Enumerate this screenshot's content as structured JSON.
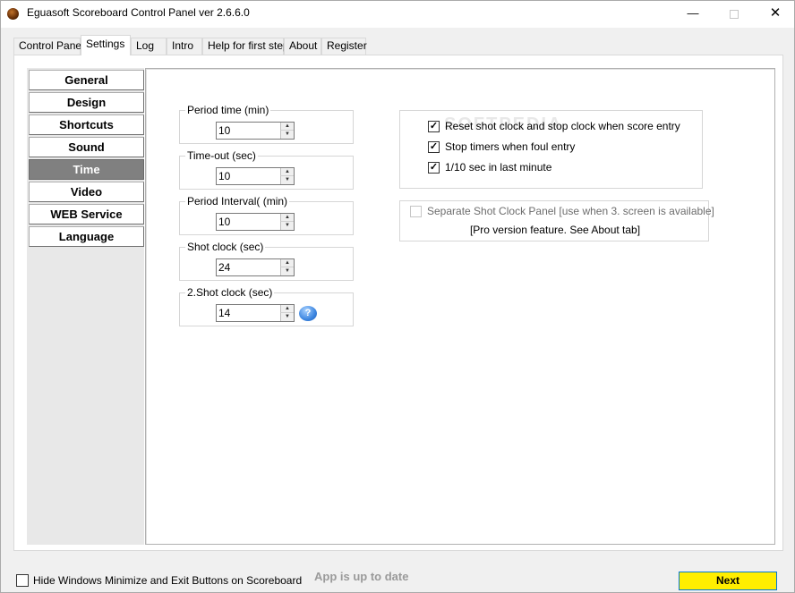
{
  "window": {
    "title": "Eguasoft Scoreboard Control Panel ver 2.6.6.0",
    "minimize_glyph": "—",
    "close_glyph": "✕"
  },
  "tabs": [
    {
      "label": "Control Panel",
      "active": false
    },
    {
      "label": "Settings",
      "active": true
    },
    {
      "label": "Log",
      "active": false
    },
    {
      "label": "Intro",
      "active": false
    },
    {
      "label": "Help for first step",
      "active": false
    },
    {
      "label": "About",
      "active": false
    },
    {
      "label": "Register",
      "active": false
    }
  ],
  "sidebar": {
    "items": [
      {
        "label": "General",
        "active": false
      },
      {
        "label": "Design",
        "active": false
      },
      {
        "label": "Shortcuts",
        "active": false
      },
      {
        "label": "Sound",
        "active": false
      },
      {
        "label": "Time",
        "active": true
      },
      {
        "label": "Video",
        "active": false
      },
      {
        "label": "WEB Service",
        "active": false
      },
      {
        "label": "Language",
        "active": false
      }
    ]
  },
  "time_settings": {
    "period_time": {
      "label": "Period time (min)",
      "value": "10"
    },
    "time_out": {
      "label": "Time-out (sec)",
      "value": "10"
    },
    "period_interval": {
      "label": "Period Interval( (min)",
      "value": "10"
    },
    "shot_clock": {
      "label": "Shot clock (sec)",
      "value": "24"
    },
    "shot_clock_2": {
      "label": "2.Shot clock (sec)",
      "value": "14"
    }
  },
  "options": {
    "reset_shot_clock": {
      "label": "Reset shot clock and stop clock when score entry",
      "checked": true
    },
    "stop_timers_foul": {
      "label": "Stop timers when foul entry",
      "checked": true
    },
    "tenth_sec_last_minute": {
      "label": "1/10 sec in last minute",
      "checked": true
    },
    "watermark": "SOFTPEDIA"
  },
  "pro_feature": {
    "label": "Separate Shot Clock Panel [use when 3. screen is available]",
    "note": "[Pro version feature. See About tab]",
    "checked": false,
    "enabled": false
  },
  "footer": {
    "hide_buttons_label": "Hide Windows Minimize and Exit Buttons on Scoreboard",
    "hide_buttons_checked": false,
    "status": "App is up to date",
    "next_label": "Next"
  },
  "icons": {
    "checkmark": "✓",
    "spin_up": "▲",
    "spin_down": "▼",
    "help": "?"
  },
  "colors": {
    "next_button": "#ffee00",
    "active_sidebar": "#808080",
    "status_text": "#9a9a9a"
  }
}
